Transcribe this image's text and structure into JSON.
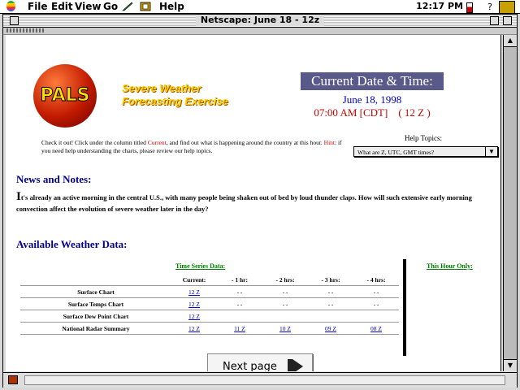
{
  "menubar": {
    "items": [
      "File",
      "Edit",
      "View",
      "Go",
      "Help"
    ],
    "clock": "12:17 PM"
  },
  "window": {
    "title": "Netscape: June 18 - 12z"
  },
  "page": {
    "logo_text": "PALS",
    "headline_line1": "Severe Weather",
    "headline_line2": "Forecasting Exercise",
    "datetime_title": "Current Date & Time:",
    "date": "June 18, 1998",
    "time": "07:00 AM [CDT]    ( 12 Z )",
    "intro_part1": "Check it out! Click under the column titled ",
    "intro_current": "Current",
    "intro_part2": ", and find out what is happening around the country at this hour. ",
    "intro_hint": "Hint",
    "intro_part3": ": if you need help understanding the charts, please review our help topics.",
    "help_topics_label": "Help Topics:",
    "help_topics_selected": "What are Z, UTC, GMT times?",
    "news_heading": "News and Notes:",
    "news_first_letter": "I",
    "news_text": "t's already an active morning in the central U.S., with many people being shaken out of bed by loud thunder claps. How will such extensive early morning convection affect the evolution of severe weather later in the day?",
    "available_heading": "Available Weather Data:",
    "time_series_label": "Time Series Data:",
    "this_hour_label": "This Hour Only:",
    "table": {
      "headers": [
        "Current:",
        "- 1 hr:",
        "- 2 hrs:",
        "- 3 hrs:",
        "- 4 hrs:"
      ],
      "rows": [
        {
          "name": "Surface Chart",
          "cells": [
            "12 Z",
            "- -",
            "- -",
            "- -",
            "- -"
          ]
        },
        {
          "name": "Surface Temps Chart",
          "cells": [
            "12 Z",
            "- -",
            "- -",
            "- -",
            "- -"
          ]
        },
        {
          "name": "Surface Dew Point Chart",
          "cells": [
            "12 Z",
            "",
            "",
            "",
            ""
          ]
        },
        {
          "name": "National Radar Summary",
          "cells": [
            "12 Z",
            "11 Z",
            "10 Z",
            "09 Z",
            "08 Z"
          ]
        }
      ]
    },
    "next_page_label": "Next page"
  }
}
